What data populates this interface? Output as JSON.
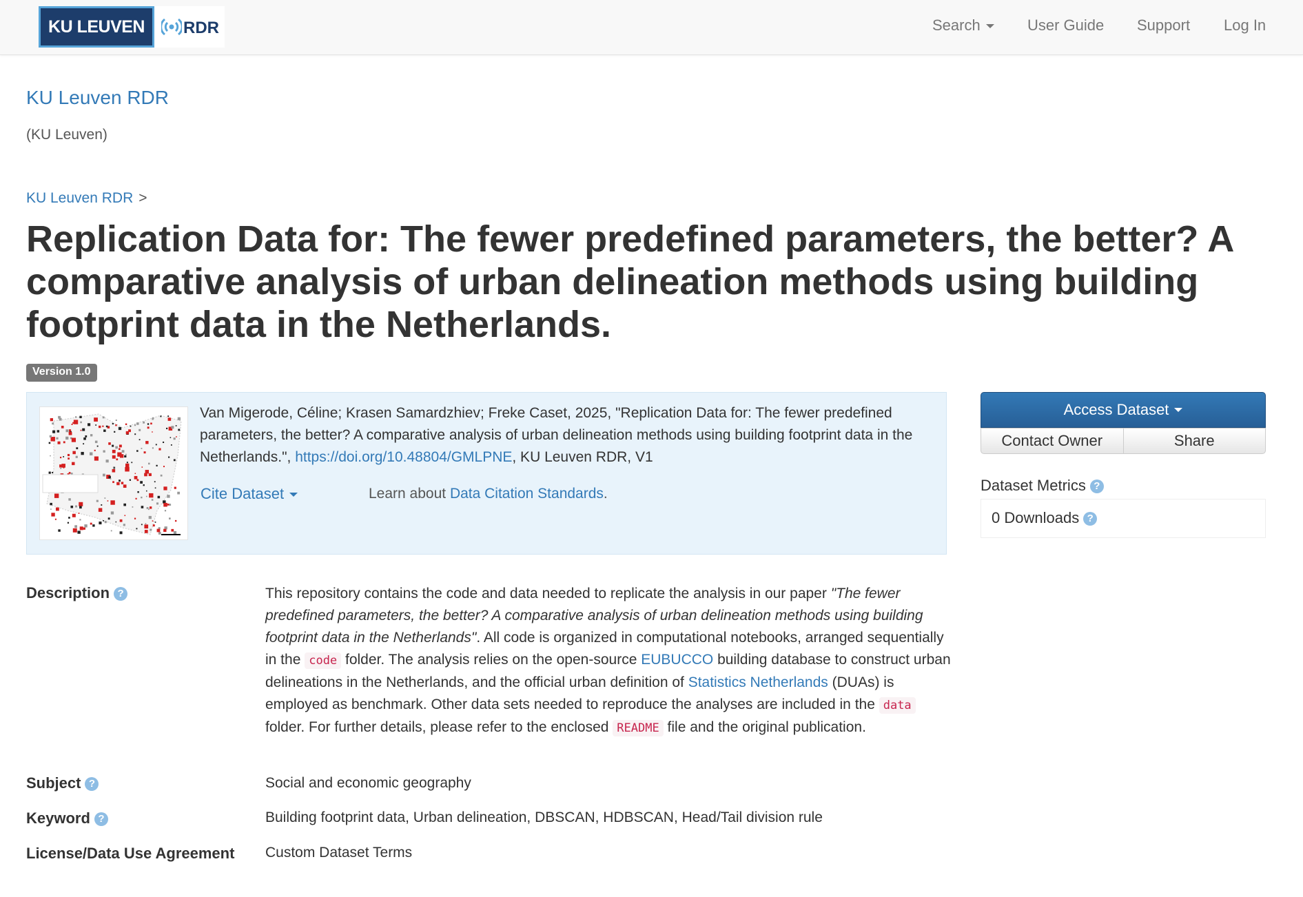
{
  "navbar": {
    "logo_ku": "KU LEUVEN",
    "logo_rdr": "RDR",
    "search_label": "Search",
    "user_guide_label": "User Guide",
    "support_label": "Support",
    "login_label": "Log In"
  },
  "dataverse": {
    "name": "KU Leuven RDR",
    "affiliation": "(KU Leuven)"
  },
  "breadcrumb": {
    "item": "KU Leuven RDR",
    "separator": ">"
  },
  "dataset": {
    "title": "Replication Data for: The fewer predefined parameters, the better? A comparative analysis of urban delineation methods using building footprint data in the Netherlands.",
    "version": "Version 1.0"
  },
  "citation": {
    "text_before": "Van Migerode, Céline; Krasen Samardzhiev; Freke Caset, 2025, \"Replication Data for: The fewer predefined parameters, the better? A comparative analysis of urban delineation methods using building footprint data in the Netherlands.\", ",
    "doi_link": "https://doi.org/10.48804/GMLPNE",
    "text_after": ", KU Leuven RDR, V1",
    "cite_dataset_label": "Cite Dataset",
    "learn_about_prefix": "Learn about ",
    "standards_link": "Data Citation Standards",
    "learn_about_suffix": "."
  },
  "actions": {
    "access_dataset": "Access Dataset",
    "contact_owner": "Contact Owner",
    "share": "Share"
  },
  "metrics": {
    "heading": "Dataset Metrics",
    "downloads": "0 Downloads"
  },
  "metadata": {
    "description_label": "Description",
    "description": {
      "p1": "This repository contains the code and data needed to replicate the analysis in our paper ",
      "paper_title": "\"The fewer predefined parameters, the better? A comparative analysis of urban delineation methods using building footprint data in the Netherlands\"",
      "p2": ". All code is organized in computational notebooks, arranged sequentially in the ",
      "code_folder": "code",
      "p3": " folder. The analysis relies on the open-source ",
      "eubucco_link": "EUBUCCO",
      "p4": " building database to construct urban delineations in the Netherlands, and the official urban definition of ",
      "cbs_link": "Statistics Netherlands",
      "p5": " (DUAs) is employed as benchmark. Other data sets needed to reproduce the analyses are included in the ",
      "data_folder": "data",
      "p6": " folder. For further details, please refer to the enclosed ",
      "readme": "README",
      "p7": " file and the original publication."
    },
    "subject_label": "Subject",
    "subject": "Social and economic geography",
    "keyword_label": "Keyword",
    "keyword": "Building footprint data, Urban delineation, DBSCAN, HDBSCAN, Head/Tail division rule",
    "license_label": "License/Data Use Agreement",
    "license_link": "Custom Dataset Terms"
  },
  "colors": {
    "link": "#337ab7",
    "primary_button": "#2e6da4",
    "citation_bg": "#e8f3fb",
    "ku_leuven_blue": "#1d3d6b",
    "code_text": "#c7254e"
  },
  "icons": {
    "help": "question-circle-icon",
    "caret": "caret-down-icon",
    "rdr_logo": "rdr-signal-icon"
  }
}
